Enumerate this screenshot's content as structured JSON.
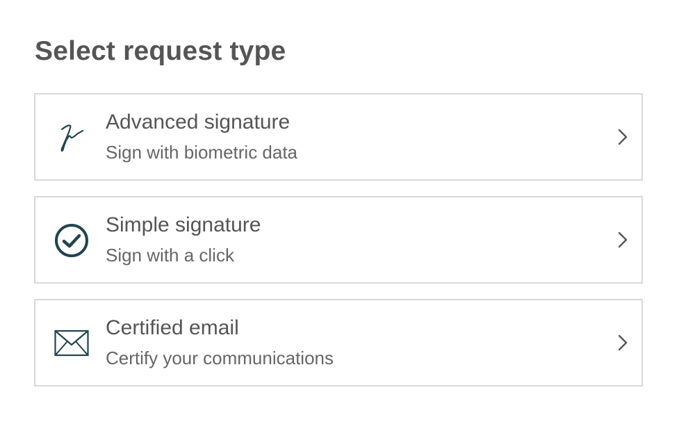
{
  "page": {
    "title": "Select request type"
  },
  "options": [
    {
      "title": "Advanced signature",
      "subtitle": "Sign with biometric data",
      "icon": "signature-icon"
    },
    {
      "title": "Simple signature",
      "subtitle": "Sign with a click",
      "icon": "check-circle-icon"
    },
    {
      "title": "Certified email",
      "subtitle": "Certify your communications",
      "icon": "envelope-icon"
    }
  ],
  "colors": {
    "icon": "#1f4550",
    "border": "#d9d9d9",
    "text": "#555555",
    "chevron": "#555555"
  }
}
